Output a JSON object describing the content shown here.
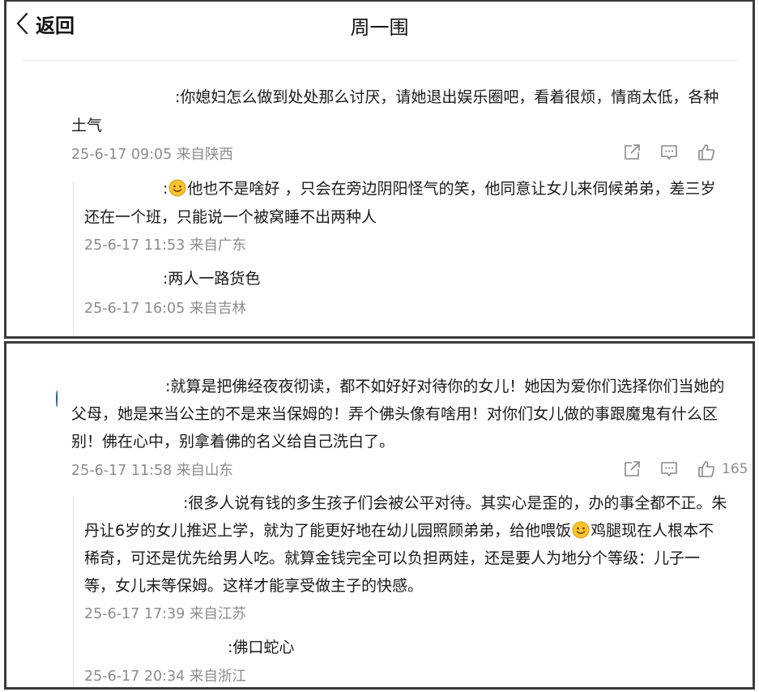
{
  "nav": {
    "back_label": "返回",
    "title": "周一围"
  },
  "panel1": {
    "comment": {
      "prefix": ":",
      "line1": "你媳妇怎么做到处处那么讨厌，请她退出娱乐圈吧，看着很烦，情商太低，各种",
      "line2": "土气",
      "meta": "25-6-17 09:05 来自陕西"
    },
    "replies": [
      {
        "prefix": ":",
        "line1": "他也不是啥好    ，只会在旁边阴阳怪气的笑，他同意让女儿来伺候弟弟，差三岁",
        "line2": "还在一个班，只能说一个被窝睡不出两种人",
        "meta": "25-6-17 11:53 来自广东"
      },
      {
        "prefix": ":",
        "line1": "两人一路货色",
        "meta": "25-6-17 16:05 来自吉林"
      }
    ]
  },
  "panel2": {
    "comment": {
      "prefix": ":",
      "line1": "就算是把佛经夜夜彻读，都不如好好对待你的女儿！她因为爱你们选择你们当她的",
      "line2": "父母，她是来当公主的不是来当保姆的！弄个佛头像有啥用！对你们女儿做的事跟魔鬼有什么区",
      "line3": "别！佛在心中，别拿着佛的名义给自己洗白了。",
      "meta": "25-6-17 11:58 来自山东",
      "likes": "165"
    },
    "replies": [
      {
        "prefix": ":",
        "line1": "很多人说有钱的多生孩子们会被公平对待。其实心是歪的，办的事全都不正。朱",
        "line2_a": "丹让6岁的女儿推迟上学，就为了能更好地在幼儿园照顾弟弟，给他喂饭",
        "line2_b": "鸡腿现在人根本不",
        "line3": "稀奇，可还是优先给男人吃。就算金钱完全可以负担两娃，还是要人为地分个等级：儿子一",
        "line4": "等，女儿末等保姆。这样才能享受做主子的快感。",
        "meta": "25-6-17 17:39 来自江苏"
      },
      {
        "prefix": ":",
        "line1": "佛口蛇心",
        "meta": "25-6-17 20:34 来自浙江"
      }
    ]
  }
}
